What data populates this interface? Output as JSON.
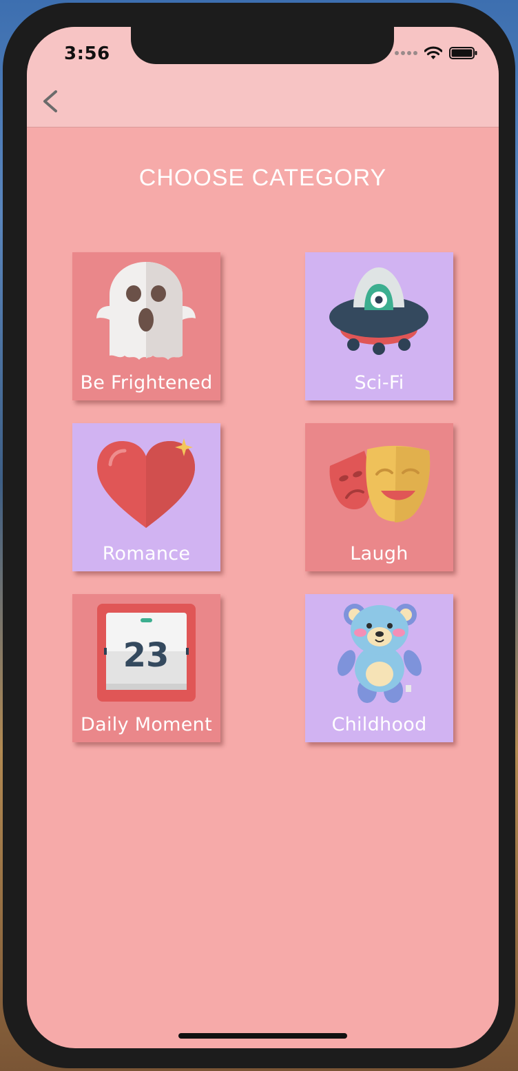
{
  "status_bar": {
    "time": "3:56"
  },
  "navigation": {
    "back_icon": "chevron-left-icon"
  },
  "page": {
    "title": "CHOOSE CATEGORY"
  },
  "colors": {
    "background": "#f6aaa9",
    "navbar": "#f7c4c4",
    "tile_red": "#ea878a",
    "tile_purple": "#d1b3f2"
  },
  "categories": [
    {
      "label": "Be Frightened",
      "icon": "ghost-icon",
      "color": "#ea878a"
    },
    {
      "label": "Sci-Fi",
      "icon": "ufo-icon",
      "color": "#d1b3f2"
    },
    {
      "label": "Romance",
      "icon": "heart-icon",
      "color": "#d1b3f2"
    },
    {
      "label": "Laugh",
      "icon": "theater-masks-icon",
      "color": "#ea878a"
    },
    {
      "label": "Daily Moment",
      "icon": "calendar-icon",
      "color": "#ea878a",
      "day": "23"
    },
    {
      "label": "Childhood",
      "icon": "teddy-bear-icon",
      "color": "#d1b3f2"
    }
  ]
}
